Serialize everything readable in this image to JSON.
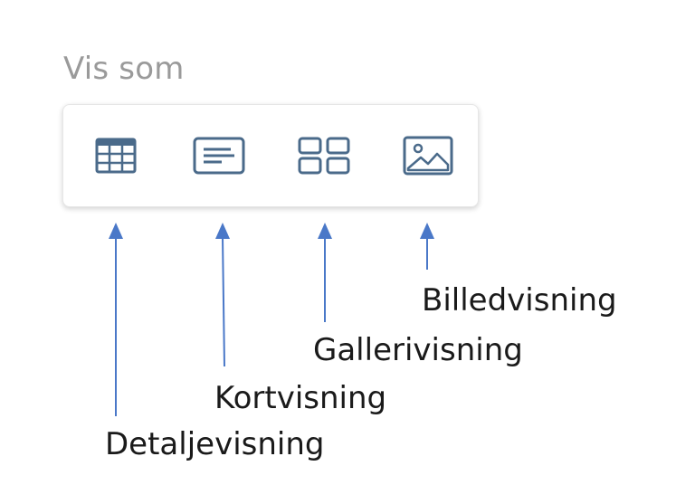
{
  "view_as": {
    "label": "Vis som"
  },
  "toolbar": {
    "buttons": [
      {
        "id": "details",
        "icon": "table-grid-icon"
      },
      {
        "id": "cards",
        "icon": "card-lines-icon"
      },
      {
        "id": "gallery",
        "icon": "four-tiles-icon"
      },
      {
        "id": "image",
        "icon": "image-picture-icon"
      }
    ]
  },
  "callouts": {
    "details": "Detaljevisning",
    "cards": "Kortvisning",
    "gallery": "Gallerivisning",
    "image": "Billedvisning"
  },
  "colors": {
    "icon": "#4a6a8a",
    "arrow": "#4a78c8",
    "label_muted": "#9a9a9a",
    "text": "#1a1a1a"
  }
}
